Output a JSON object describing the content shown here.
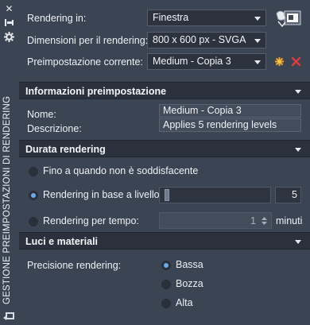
{
  "vertical_title": "GESTIONE PREIMPOSTAZIONI DI RENDERING",
  "top": {
    "render_in_label": "Rendering in:",
    "render_in_value": "Finestra",
    "size_label": "Dimensioni per il rendering:",
    "size_value": "800 x 600 px - SVGA",
    "preset_label": "Preimpostazione corrente:",
    "preset_value": "Medium - Copia 3"
  },
  "info": {
    "header": "Informazioni preimpostazione",
    "name_label": "Nome:",
    "name_value": "Medium - Copia 3",
    "desc_label": "Descrizione:",
    "desc_value": "Applies 5 rendering levels"
  },
  "duration": {
    "header": "Durata rendering",
    "option_until": "Fino a quando non è soddisfacente",
    "option_level": "Rendering in base a livello:",
    "level_value": "5",
    "level_fraction": 0.03,
    "option_time": "Rendering per tempo:",
    "time_value": "1",
    "time_unit": "minuti",
    "selected": "level"
  },
  "lights": {
    "header": "Luci e materiali",
    "precision_label": "Precisione rendering:",
    "opt_low": "Bassa",
    "opt_draft": "Bozza",
    "opt_high": "Alta",
    "selected": "low"
  },
  "colors": {
    "panel_bg": "#3b4453",
    "header_bg": "#2b313c",
    "accent": "#6aa9ec",
    "delete_red": "#e03a3a",
    "new_orange": "#f0a22a"
  }
}
